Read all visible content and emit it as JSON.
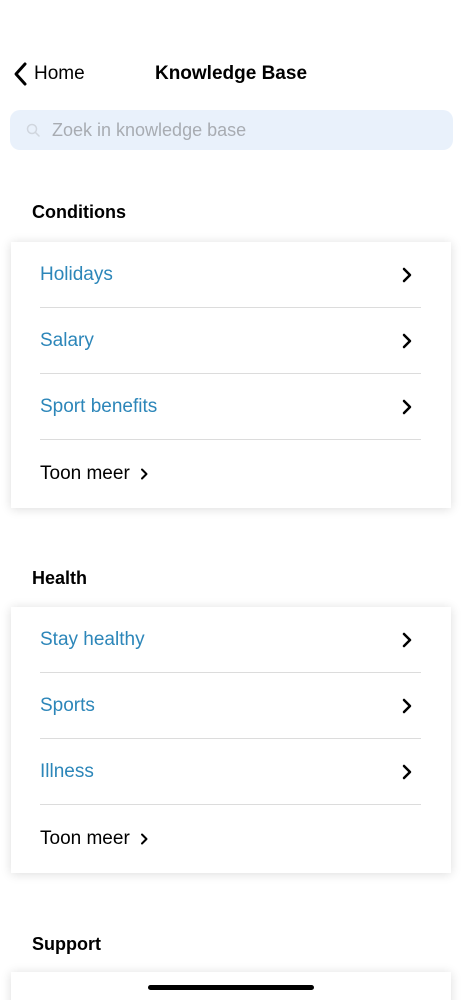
{
  "nav": {
    "back_label": "Home",
    "title": "Knowledge Base"
  },
  "search": {
    "placeholder": "Zoek in knowledge base",
    "value": ""
  },
  "sections": [
    {
      "title": "Conditions",
      "items": [
        {
          "label": "Holidays"
        },
        {
          "label": "Salary"
        },
        {
          "label": "Sport benefits"
        }
      ],
      "more_label": "Toon meer"
    },
    {
      "title": "Health",
      "items": [
        {
          "label": "Stay healthy"
        },
        {
          "label": "Sports"
        },
        {
          "label": "Illness"
        }
      ],
      "more_label": "Toon meer"
    },
    {
      "title": "Support",
      "items": [],
      "more_label": ""
    }
  ],
  "colors": {
    "link": "#2c86b9",
    "search_bg": "#e9f1fb",
    "divider": "#dcdcdc"
  },
  "icons": {
    "back": "chevron-left-icon",
    "search": "search-icon",
    "item": "chevron-right-icon"
  }
}
